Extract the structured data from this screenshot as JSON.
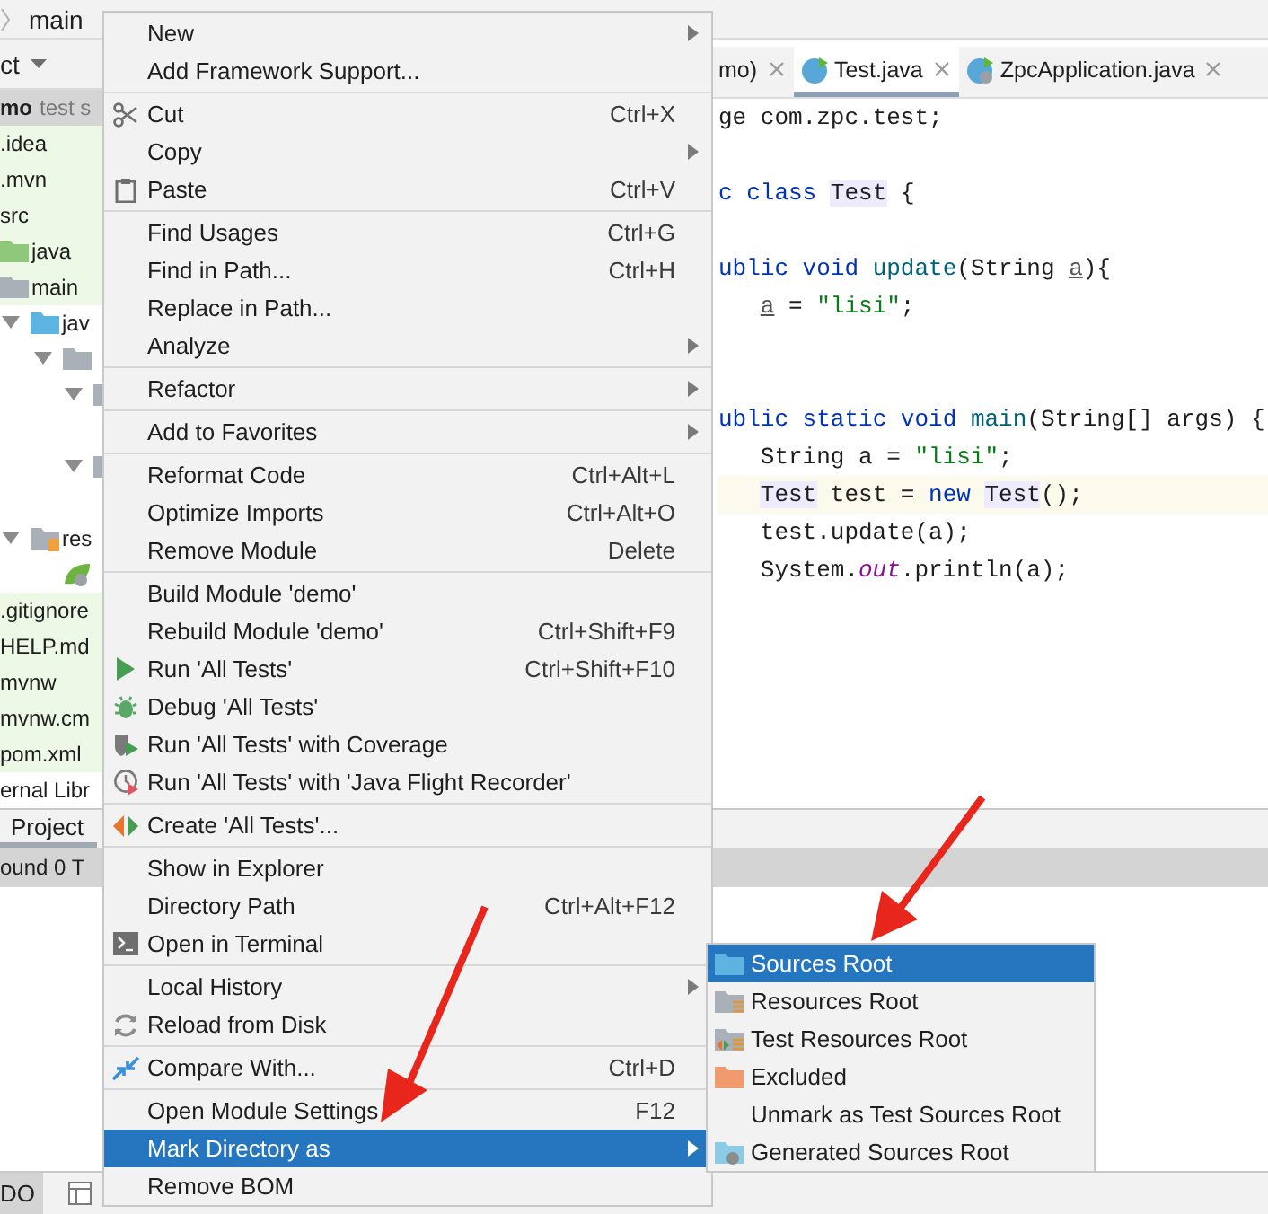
{
  "breadcrumb": {
    "label": "main"
  },
  "project_panel": {
    "title": "ct",
    "tree": [
      {
        "label": "mo",
        "note": "test s",
        "selected": true,
        "children": [
          {
            "label": ".idea",
            "tinted": true
          },
          {
            "label": ".mvn",
            "tinted": true
          },
          {
            "label": "src",
            "tinted": true,
            "children": [
              {
                "label": "java",
                "kind": "folder-green",
                "tinted": true
              },
              {
                "label": "main",
                "kind": "folder-grey",
                "tinted": true,
                "children": [
                  {
                    "label": "jav",
                    "kind": "folder-blue",
                    "expanded": true,
                    "children": [
                      {
                        "kind": "folder-grey",
                        "expanded": true,
                        "children": [
                          {
                            "kind": "folder-grey",
                            "expanded": true
                          },
                          {
                            "kind": "blank"
                          },
                          {
                            "kind": "folder-grey",
                            "expanded": true
                          },
                          {
                            "kind": "blank"
                          }
                        ]
                      }
                    ]
                  },
                  {
                    "label": "res",
                    "kind": "folder-res",
                    "expanded": true,
                    "children": [
                      {
                        "kind": "spring"
                      }
                    ]
                  }
                ]
              }
            ]
          },
          {
            "label": ".gitignore",
            "tinted": true
          },
          {
            "label": "HELP.md",
            "tinted": true
          },
          {
            "label": "mvnw",
            "tinted": true
          },
          {
            "label": "mvnw.cm",
            "tinted": true
          },
          {
            "label": "pom.xml",
            "tinted": true
          }
        ]
      },
      {
        "label": "ernal Libr"
      }
    ]
  },
  "tool_tab": {
    "label": "Project"
  },
  "run_bar": {
    "label": "ound 0 T"
  },
  "bottom_tab": {
    "label": "DO"
  },
  "editor": {
    "tabs": [
      {
        "label": "mo)",
        "selected": false
      },
      {
        "label": "Test.java",
        "selected": true,
        "kind": "class"
      },
      {
        "label": "ZpcApplication.java",
        "selected": false,
        "kind": "spring-class"
      }
    ],
    "lines": [
      {
        "current": false,
        "nested": false,
        "tokens": [
          {
            "t": "ge com.zpc.test;",
            "kind": "plain"
          }
        ]
      },
      {
        "current": false
      },
      {
        "current": false,
        "nested": false,
        "tokens": [
          {
            "t": "c class ",
            "kind": "keyword"
          },
          {
            "t": "Test",
            "kind": "usage"
          },
          {
            "t": " {",
            "kind": "plain"
          }
        ]
      },
      {
        "current": false
      },
      {
        "current": false,
        "nested": false,
        "tokens": [
          {
            "t": "ublic void ",
            "kind": "keyword"
          },
          {
            "t": "update",
            "kind": "method"
          },
          {
            "t": "(String ",
            "kind": "plain"
          },
          {
            "t": "a",
            "kind": "param"
          },
          {
            "t": "){",
            "kind": "plain"
          }
        ]
      },
      {
        "current": false,
        "nested": true,
        "tokens": [
          {
            "t": "a",
            "kind": "param"
          },
          {
            "t": " = ",
            "kind": "plain"
          },
          {
            "t": "\"lisi\"",
            "kind": "string"
          },
          {
            "t": ";",
            "kind": "plain"
          }
        ]
      },
      {
        "current": false
      },
      {
        "current": false
      },
      {
        "current": false,
        "nested": false,
        "tokens": [
          {
            "t": "ublic static void ",
            "kind": "keyword"
          },
          {
            "t": "main",
            "kind": "method"
          },
          {
            "t": "(String[] args) {",
            "kind": "plain"
          }
        ]
      },
      {
        "current": false,
        "nested": true,
        "tokens": [
          {
            "t": "String a = ",
            "kind": "plain"
          },
          {
            "t": "\"lisi\"",
            "kind": "string"
          },
          {
            "t": ";",
            "kind": "plain"
          }
        ]
      },
      {
        "current": true,
        "nested": true,
        "tokens": [
          {
            "t": "Test",
            "kind": "usage"
          },
          {
            "t": " test = ",
            "kind": "plain"
          },
          {
            "t": "new ",
            "kind": "keyword"
          },
          {
            "t": "Test",
            "kind": "usage"
          },
          {
            "t": "();",
            "kind": "plain"
          }
        ]
      },
      {
        "current": false,
        "nested": true,
        "tokens": [
          {
            "t": "test.update(a);",
            "kind": "plain"
          }
        ]
      },
      {
        "current": false,
        "nested": true,
        "tokens": [
          {
            "t": "System.",
            "kind": "plain"
          },
          {
            "t": "out",
            "kind": "field"
          },
          {
            "t": ".println(a);",
            "kind": "plain"
          }
        ]
      }
    ]
  },
  "context_menu": {
    "groups": [
      [
        {
          "label": "New",
          "submenu": true,
          "selected": false
        },
        {
          "label": "Add Framework Support...",
          "submenu": false,
          "selected": false
        }
      ],
      [
        {
          "label": "Cut",
          "shortcut": "Ctrl+X",
          "kind": "scissors",
          "submenu": false,
          "selected": false
        },
        {
          "label": "Copy",
          "submenu": true,
          "selected": false
        },
        {
          "label": "Paste",
          "shortcut": "Ctrl+V",
          "kind": "clipboard",
          "submenu": false,
          "selected": false
        }
      ],
      [
        {
          "label": "Find Usages",
          "shortcut": "Ctrl+G",
          "submenu": false,
          "selected": false
        },
        {
          "label": "Find in Path...",
          "shortcut": "Ctrl+H",
          "submenu": false,
          "selected": false
        },
        {
          "label": "Replace in Path...",
          "submenu": false,
          "selected": false
        },
        {
          "label": "Analyze",
          "submenu": true,
          "selected": false
        }
      ],
      [
        {
          "label": "Refactor",
          "submenu": true,
          "selected": false
        }
      ],
      [
        {
          "label": "Add to Favorites",
          "submenu": true,
          "selected": false
        }
      ],
      [
        {
          "label": "Reformat Code",
          "shortcut": "Ctrl+Alt+L",
          "submenu": false,
          "selected": false
        },
        {
          "label": "Optimize Imports",
          "shortcut": "Ctrl+Alt+O",
          "submenu": false,
          "selected": false
        },
        {
          "label": "Remove Module",
          "shortcut": "Delete",
          "submenu": false,
          "selected": false
        }
      ],
      [
        {
          "label": "Build Module 'demo'",
          "submenu": false,
          "selected": false
        },
        {
          "label": "Rebuild Module 'demo'",
          "shortcut": "Ctrl+Shift+F9",
          "submenu": false,
          "selected": false
        },
        {
          "label": "Run 'All Tests'",
          "shortcut": "Ctrl+Shift+F10",
          "kind": "run",
          "submenu": false,
          "selected": false
        },
        {
          "label": "Debug 'All Tests'",
          "kind": "debug",
          "submenu": false,
          "selected": false
        },
        {
          "label": "Run 'All Tests' with Coverage",
          "kind": "coverage",
          "submenu": false,
          "selected": false
        },
        {
          "label": "Run 'All Tests' with 'Java Flight Recorder'",
          "kind": "profiler",
          "submenu": false,
          "selected": false
        }
      ],
      [
        {
          "label": "Create 'All Tests'...",
          "kind": "create-test",
          "submenu": false,
          "selected": false
        }
      ],
      [
        {
          "label": "Show in Explorer",
          "submenu": false,
          "selected": false
        },
        {
          "label": "Directory Path",
          "shortcut": "Ctrl+Alt+F12",
          "submenu": false,
          "selected": false
        },
        {
          "label": "Open in Terminal",
          "kind": "terminal",
          "submenu": false,
          "selected": false
        }
      ],
      [
        {
          "label": "Local History",
          "submenu": true,
          "selected": false
        },
        {
          "label": "Reload from Disk",
          "kind": "reload",
          "submenu": false,
          "selected": false
        }
      ],
      [
        {
          "label": "Compare With...",
          "shortcut": "Ctrl+D",
          "kind": "compare",
          "submenu": false,
          "selected": false
        }
      ],
      [
        {
          "label": "Open Module Settings",
          "shortcut": "F12",
          "submenu": false,
          "selected": false
        },
        {
          "label": "Mark Directory as",
          "submenu": true,
          "selected": true
        },
        {
          "label": "Remove BOM",
          "submenu": false,
          "selected": false
        }
      ]
    ]
  },
  "submenu": {
    "items": [
      {
        "label": "Sources Root",
        "kind": "folder-blue",
        "selected": true
      },
      {
        "label": "Resources Root",
        "kind": "folder-res",
        "selected": false
      },
      {
        "label": "Test Resources Root",
        "kind": "folder-test-res",
        "selected": false
      },
      {
        "label": "Excluded",
        "kind": "folder-orange",
        "selected": false
      },
      {
        "label": "Unmark as Test Sources Root",
        "selected": false
      },
      {
        "label": "Generated Sources Root",
        "kind": "folder-gen",
        "selected": false
      }
    ]
  }
}
